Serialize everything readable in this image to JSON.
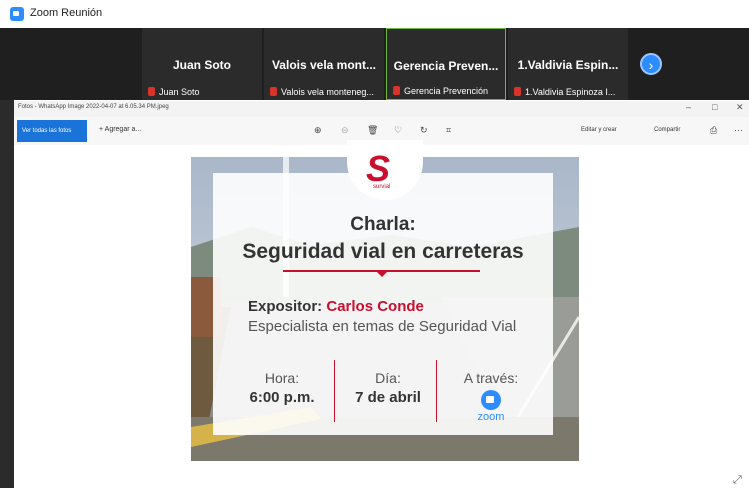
{
  "zoom": {
    "window_title": "Zoom Reunión",
    "participants": [
      {
        "name": "Juan Soto",
        "label": "Juan Soto"
      },
      {
        "name": "Valois vela mont...",
        "label": "Valois vela monteneg..."
      },
      {
        "name": "Gerencia Preven...",
        "label": "Gerencia Prevención"
      },
      {
        "name": "1.Valdivia Espin...",
        "label": "1.Valdivia Espinoza I..."
      }
    ],
    "next_glyph": "›"
  },
  "photos": {
    "title": "Fotos - WhatsApp Image 2022-04-07 at 6.05.34 PM.jpeg",
    "see_all": "Ver todas las fotos",
    "add": "+ Agregar a...",
    "edit": "Editar y crear",
    "share": "Compartir",
    "window_controls": [
      "–",
      "□",
      "✕"
    ]
  },
  "poster": {
    "brand": "survial",
    "logo_letter": "S",
    "title": "Charla:",
    "subtitle": "Seguridad vial en carreteras",
    "speaker_label": "Expositor:",
    "speaker_name": "Carlos Conde",
    "speaker_role": "Especialista en temas de Seguridad Vial",
    "hour_label": "Hora:",
    "hour_value": "6:00 p.m.",
    "day_label": "Día:",
    "day_value": "7 de abril",
    "via_label": "A través:",
    "via_value": "zoom"
  },
  "colors": {
    "zoom_blue": "#2d8cff",
    "brand_red": "#c8102e"
  }
}
